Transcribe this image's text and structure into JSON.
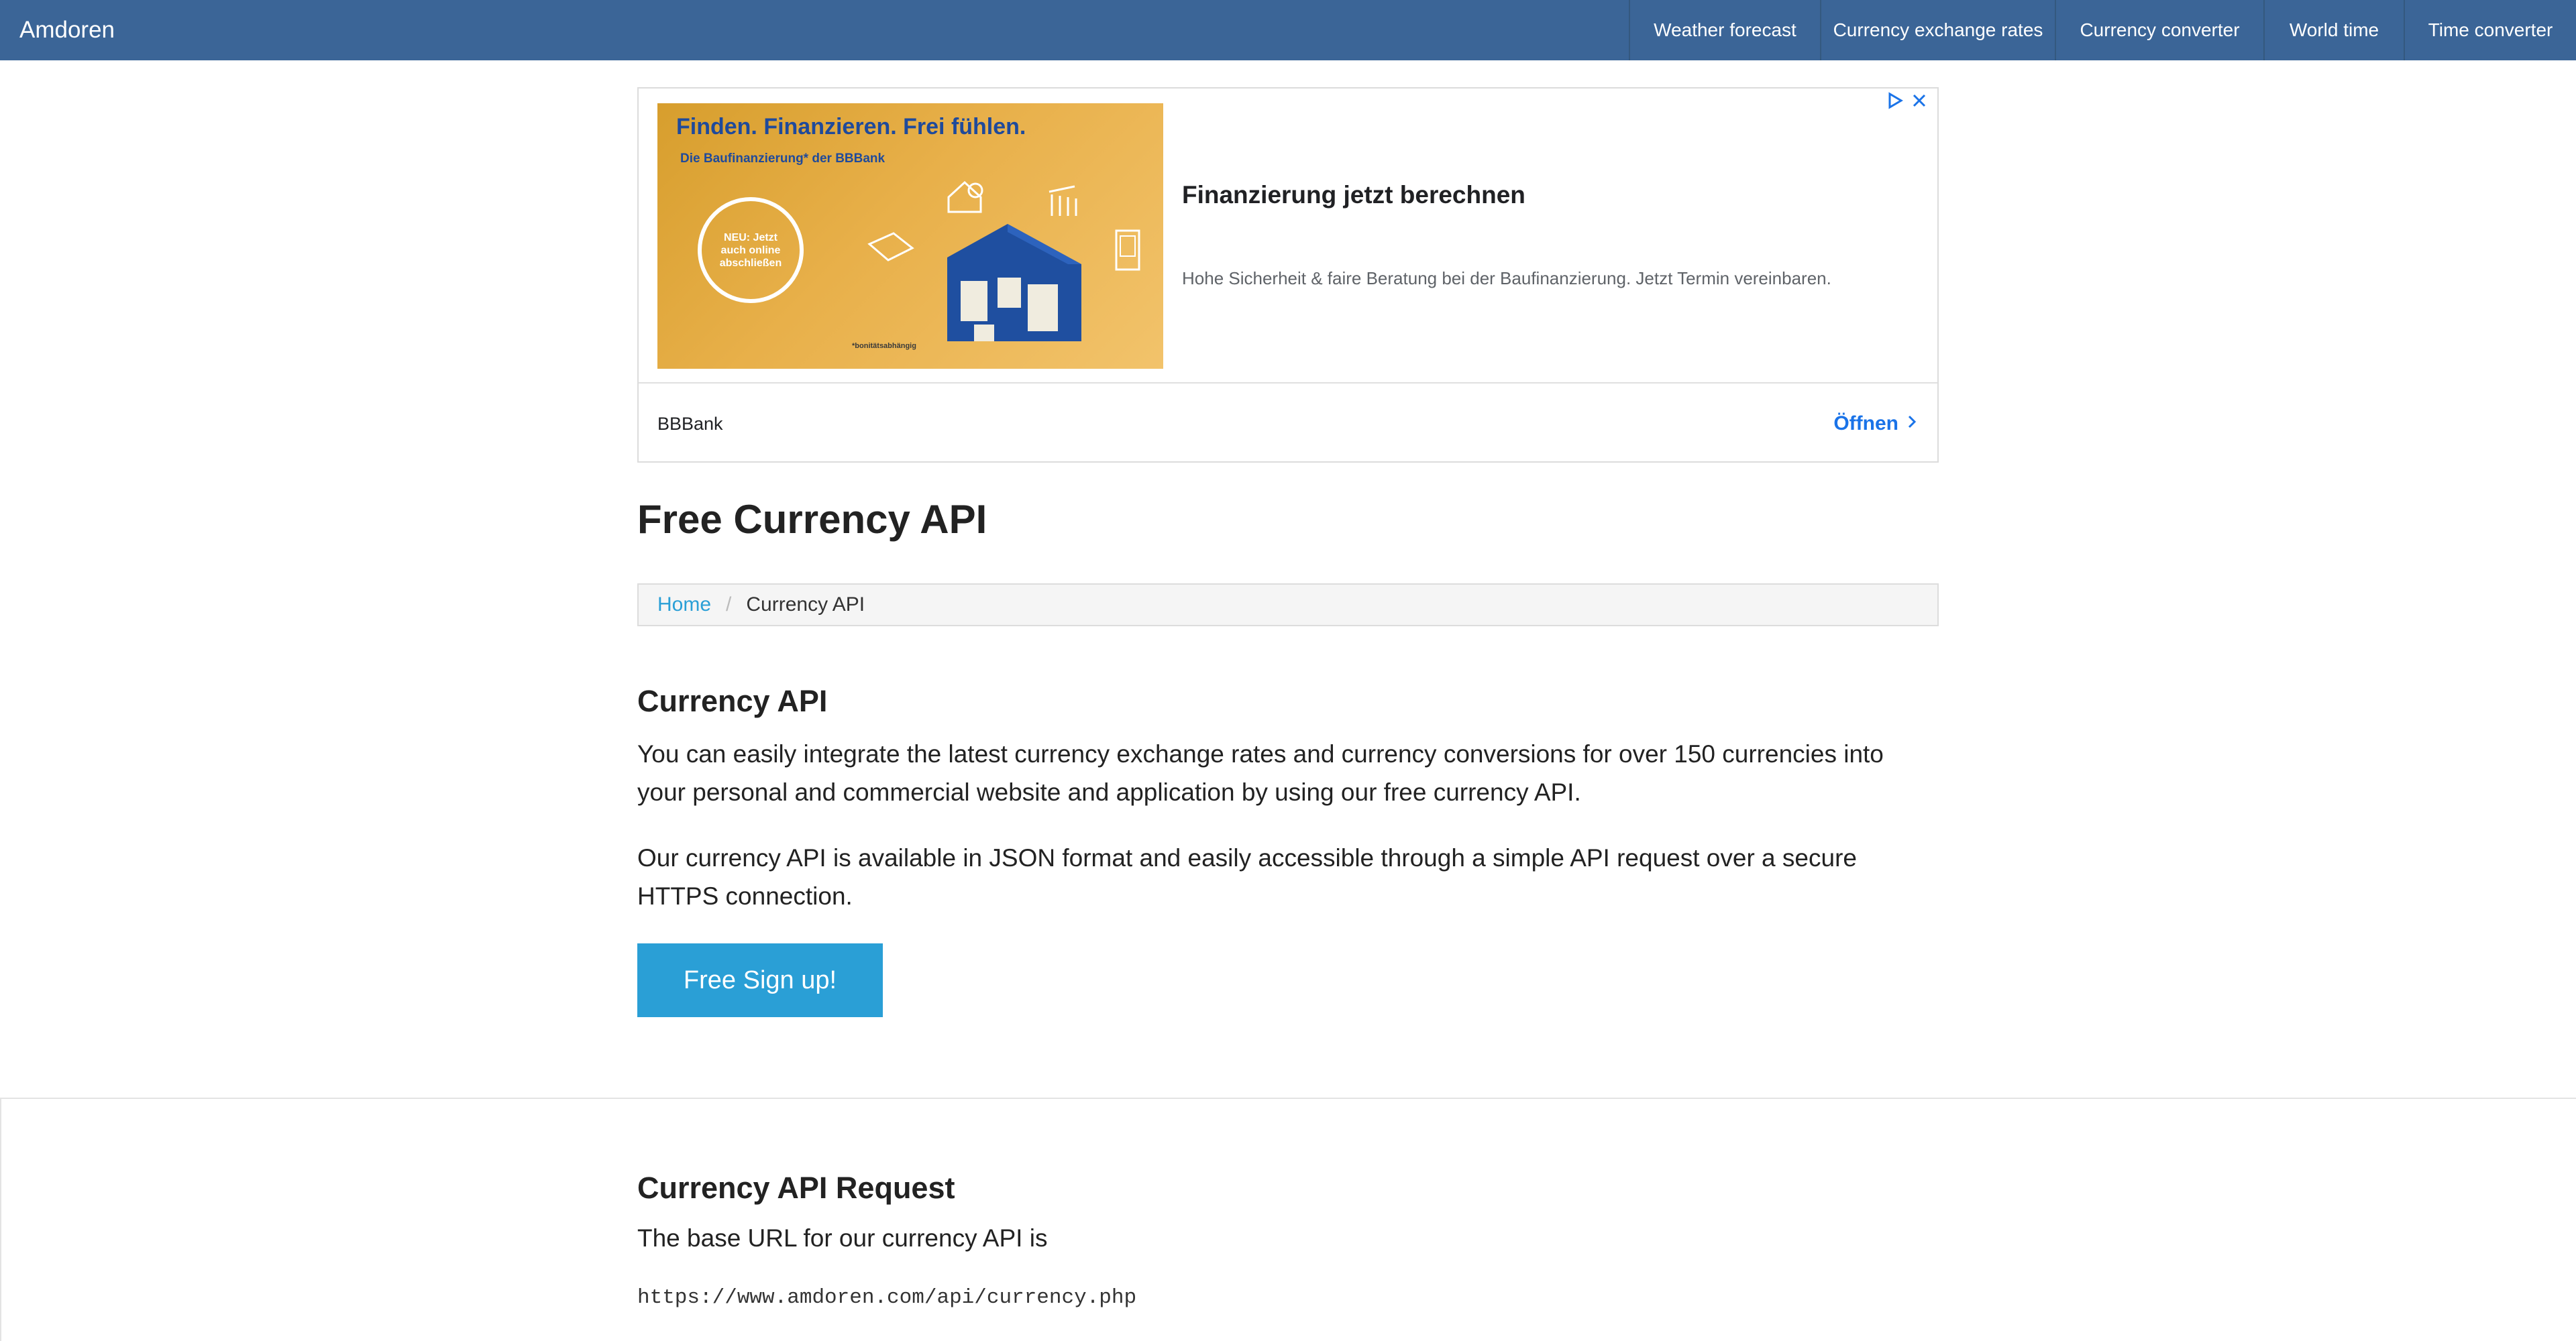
{
  "navbar": {
    "brand": "Amdoren",
    "items": [
      {
        "label": "Weather forecast"
      },
      {
        "label": "Currency exchange rates"
      },
      {
        "label": "Currency converter"
      },
      {
        "label": "World time"
      },
      {
        "label": "Time converter"
      }
    ],
    "bg_color": "#3b6597"
  },
  "ad": {
    "image_headline": "Finden. Finanzieren. Frei fühlen.",
    "image_subline": "Die Baufinanzierung* der BBBank",
    "image_badge": "NEU: Jetzt auch online abschließen",
    "image_footnote": "*bonitätsabhängig",
    "title": "Finanzierung jetzt berechnen",
    "description": "Hohe Sicherheit & faire Beratung bei der Baufinanzierung. Jetzt Termin vereinbaren.",
    "advertiser": "BBBank",
    "open_label": "Öffnen",
    "adchoices_icon": "adchoices-icon",
    "close_icon": "close-icon"
  },
  "page": {
    "title": "Free Currency API",
    "breadcrumb": {
      "home": "Home",
      "separator": "/",
      "current": "Currency API"
    },
    "section1": {
      "title": "Currency API",
      "para1": "You can easily integrate the latest currency exchange rates and currency conversions for over 150 currencies into your personal and commercial website and application by using our free currency API.",
      "para2": "Our currency API is available in JSON format and easily accessible through a simple API request over a secure HTTPS connection."
    },
    "signup_label": "Free Sign up!",
    "accent_color": "#2a9fd6",
    "section2": {
      "title": "Currency API Request",
      "para": "The base URL for our currency API is",
      "url": "https://www.amdoren.com/api/currency.php"
    }
  }
}
